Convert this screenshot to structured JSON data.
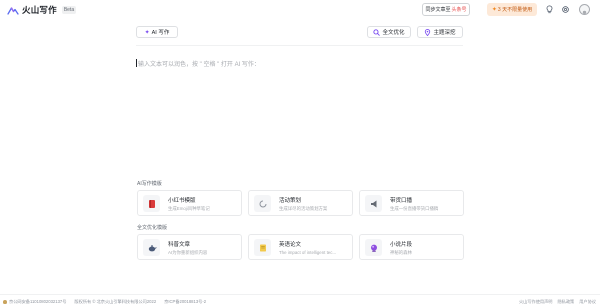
{
  "app": {
    "name": "火山写作",
    "badge": "Beta"
  },
  "header": {
    "sync": {
      "label": "同步文章至",
      "target": "头条号"
    },
    "trial": {
      "label": "3 天不限量使用"
    },
    "icons": [
      "lightbulb-icon",
      "settings-icon",
      "user-avatar-icon"
    ]
  },
  "toolbar": {
    "ai_write_label": "AI 写作",
    "full_polish_label": "全文优化",
    "deep_research_label": "主题深挖"
  },
  "editor": {
    "placeholder": "输入文本可以润色，按 \" 空格 \" 打开 AI 写作："
  },
  "ai_templates": {
    "title": "AI写作模版",
    "cards": [
      {
        "title": "小红书模版",
        "desc": "生成Emoji风种草笔记",
        "icon": "red-book-icon"
      },
      {
        "title": "活动策划",
        "desc": "生成详尽的活动策划方案",
        "icon": "loading-circle-icon"
      },
      {
        "title": "带货口播",
        "desc": "生成一份直播带货口播稿",
        "icon": "megaphone-icon"
      }
    ]
  },
  "polish_templates": {
    "title": "全文优化模版",
    "cards": [
      {
        "title": "科普文章",
        "desc": "AI为你重新组织内容",
        "icon": "teapot-icon"
      },
      {
        "title": "英语论文",
        "desc": "The impact of intelligent tec...",
        "icon": "notebook-icon"
      },
      {
        "title": "小说片段",
        "desc": "神秘的森林",
        "icon": "crystal-ball-icon"
      }
    ]
  },
  "footer": {
    "beian": "京公网安备11010802032137号",
    "copyright": "版权所有 © 北京火山引擎科技有限公司2022",
    "icp": "京ICP备20018813号-2",
    "links": [
      "火山写作使用声明",
      "隐私政策",
      "用户协议"
    ]
  },
  "colors": {
    "accent": "#7b4ef0",
    "trial_bg": "#fde9d8",
    "trial_text": "#c25a12",
    "highlight_red": "#e64a4a"
  }
}
